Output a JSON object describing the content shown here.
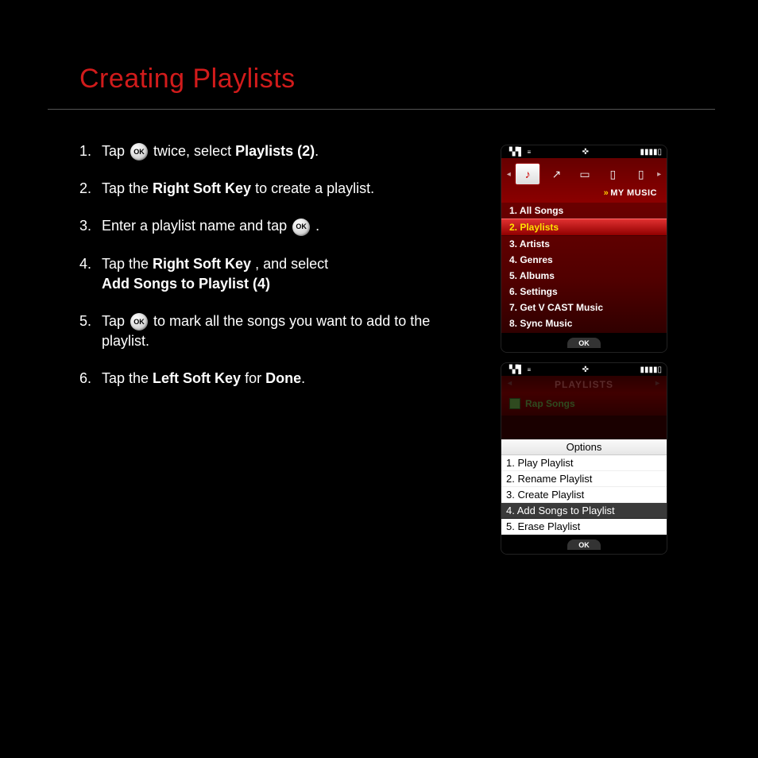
{
  "title": "Creating Playlists",
  "ok_label": "OK",
  "steps": {
    "s1": {
      "num": "1.",
      "a": "Tap ",
      "b": " twice, select ",
      "bold": "Playlists (2)",
      "c": "."
    },
    "s2": {
      "num": "2.",
      "a": "Tap the ",
      "bold": "Right Soft Key",
      "b": " to create a playlist."
    },
    "s3": {
      "num": "3.",
      "a": "Enter a playlist name and tap ",
      "b": " ."
    },
    "s4": {
      "num": "4.",
      "a": "Tap the ",
      "bold1": "Right Soft Key",
      "b": ", and select ",
      "bold2": "Add Songs to Playlist (4)"
    },
    "s5": {
      "num": "5.",
      "a": "Tap ",
      "b": " to mark all the songs you want to add to the playlist."
    },
    "s6": {
      "num": "6.",
      "a": "Tap the ",
      "bold1": "Left Soft Key",
      "b": " for ",
      "bold2": "Done",
      "c": "."
    }
  },
  "phone1": {
    "header": "MY MUSIC",
    "items": [
      "1. All Songs",
      "2. Playlists",
      "3. Artists",
      "4. Genres",
      "5. Albums",
      "6. Settings",
      "7. Get V CAST Music",
      "8. Sync Music"
    ],
    "selected_index": 1,
    "soft_ok": "OK"
  },
  "phone2": {
    "header": "PLAYLISTS",
    "song": "Rap Songs",
    "options_title": "Options",
    "options": [
      "1. Play Playlist",
      "2. Rename Playlist",
      "3. Create Playlist",
      "4. Add Songs to Playlist",
      "5. Erase Playlist"
    ],
    "selected_option_index": 3,
    "soft_ok": "OK"
  }
}
